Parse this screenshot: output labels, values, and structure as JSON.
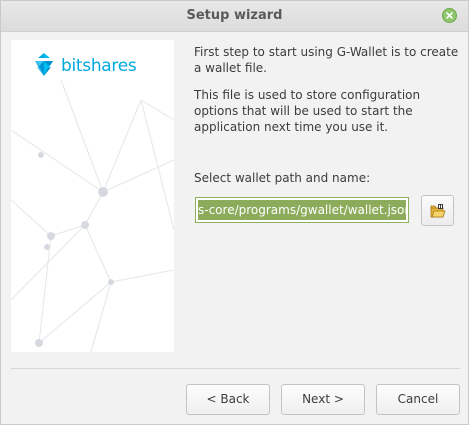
{
  "window": {
    "title": "Setup wizard",
    "close_icon": "close-icon"
  },
  "side_panel": {
    "logo_text": "bitshares",
    "brand_color": "#00a9e0"
  },
  "content": {
    "paragraph1": "First step to start using G-Wallet is to create a wallet file.",
    "paragraph2": "This file is used to store configuration options that will be used to start the application next time you use it.",
    "path_label": "Select wallet path and name:",
    "path_value": "s-core/programs/gwallet/wallet.json",
    "browse_icon": "folder-open-icon"
  },
  "buttons": {
    "back": "< Back",
    "next": "Next >",
    "cancel": "Cancel"
  }
}
